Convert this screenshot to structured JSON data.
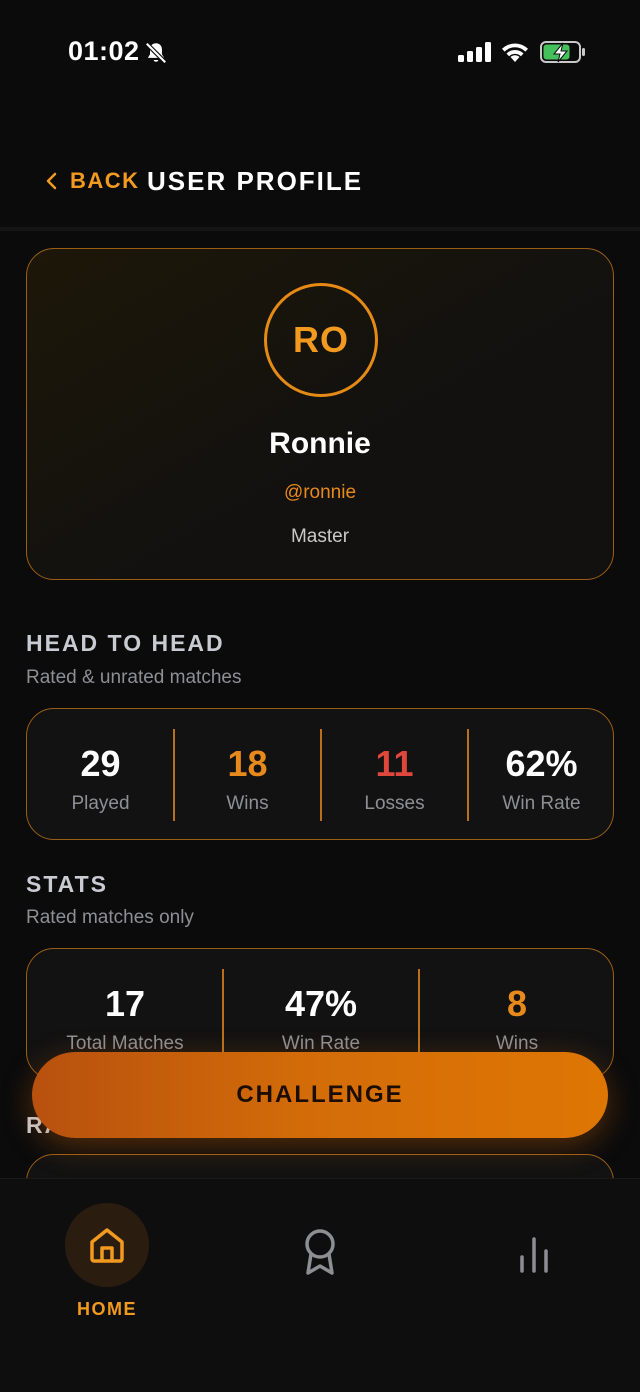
{
  "status_bar": {
    "time": "01:02",
    "icons": [
      "bell-slash-icon",
      "cellular-signal-icon",
      "wifi-icon",
      "battery-charging-icon"
    ]
  },
  "header": {
    "back_label": "BACK",
    "title": "USER PROFILE"
  },
  "profile": {
    "initials": "RO",
    "name": "Ronnie",
    "handle": "@ronnie",
    "rank": "Master"
  },
  "head_to_head": {
    "title": "HEAD TO HEAD",
    "subtitle": "Rated & unrated matches",
    "stats": [
      {
        "value": "29",
        "label": "Played",
        "color": "#ffffff"
      },
      {
        "value": "18",
        "label": "Wins",
        "color": "#e8891c"
      },
      {
        "value": "11",
        "label": "Losses",
        "color": "#e0473c"
      },
      {
        "value": "62%",
        "label": "Win Rate",
        "color": "#ffffff"
      }
    ]
  },
  "stats": {
    "title": "STATS",
    "subtitle": "Rated matches only",
    "items": [
      {
        "value": "17",
        "label": "Total Matches",
        "color": "#ffffff"
      },
      {
        "value": "47%",
        "label": "Win Rate",
        "color": "#ffffff"
      },
      {
        "value": "8",
        "label": "Wins",
        "color": "#e8891c"
      }
    ]
  },
  "challenge_button": {
    "label": "CHALLENGE"
  },
  "next_section": {
    "visible_fragment": "RA"
  },
  "bottom_nav": {
    "items": [
      {
        "label": "HOME",
        "icon": "home-icon",
        "active": true
      },
      {
        "label": "",
        "icon": "award-icon",
        "active": false
      },
      {
        "label": "",
        "icon": "bar-chart-icon",
        "active": false
      }
    ]
  },
  "colors": {
    "accent": "#f29a1f",
    "loss": "#e0473c",
    "background": "#0b0b0c"
  }
}
